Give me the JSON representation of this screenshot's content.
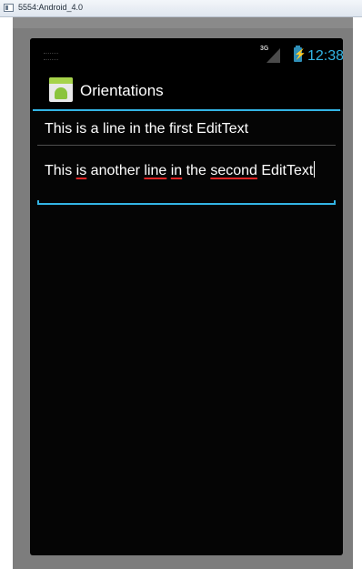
{
  "window": {
    "title": "5554:Android_4.0"
  },
  "statusbar": {
    "network_type": "3G",
    "time": "12:38"
  },
  "actionbar": {
    "title": "Orientations"
  },
  "edit_texts": [
    {
      "value": "This is a line in the first EditText"
    },
    {
      "segments": [
        "This ",
        "is",
        " another ",
        "line",
        " ",
        "in",
        " the ",
        "second",
        " EditText"
      ]
    }
  ],
  "colors": {
    "accent": "#33b5e5",
    "spellcheck": "#e02525"
  }
}
